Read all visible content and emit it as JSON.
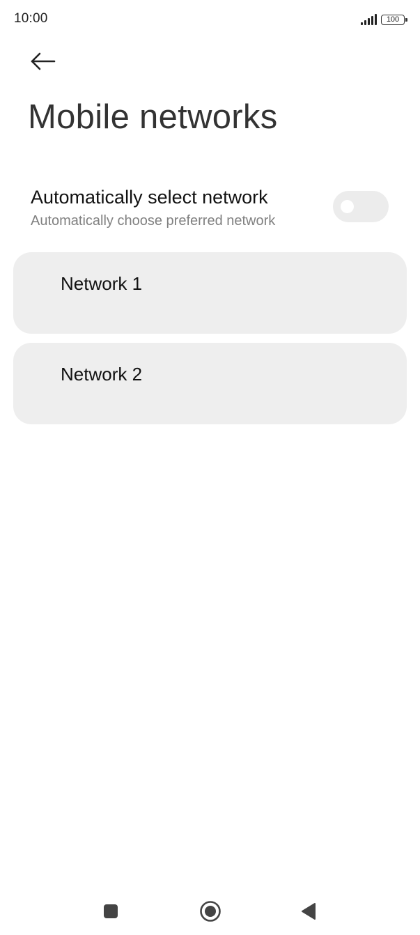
{
  "status_bar": {
    "time": "10:00",
    "battery": "100",
    "icons": [
      "signal-icon",
      "battery-icon"
    ]
  },
  "header": {
    "back_icon": "arrow-left-icon",
    "title": "Mobile networks"
  },
  "auto_select": {
    "title": "Automatically select network",
    "subtitle": "Automatically choose preferred network",
    "enabled": false
  },
  "networks": [
    {
      "label": "Network 1"
    },
    {
      "label": "Network 2"
    }
  ],
  "nav_bar": {
    "icons": [
      "recents-square-icon",
      "home-circle-icon",
      "back-triangle-icon"
    ]
  },
  "colors": {
    "background": "#ffffff",
    "card": "#eeeeee",
    "toggle_off": "#ececec",
    "subtitle": "#808080",
    "title": "#333333"
  }
}
